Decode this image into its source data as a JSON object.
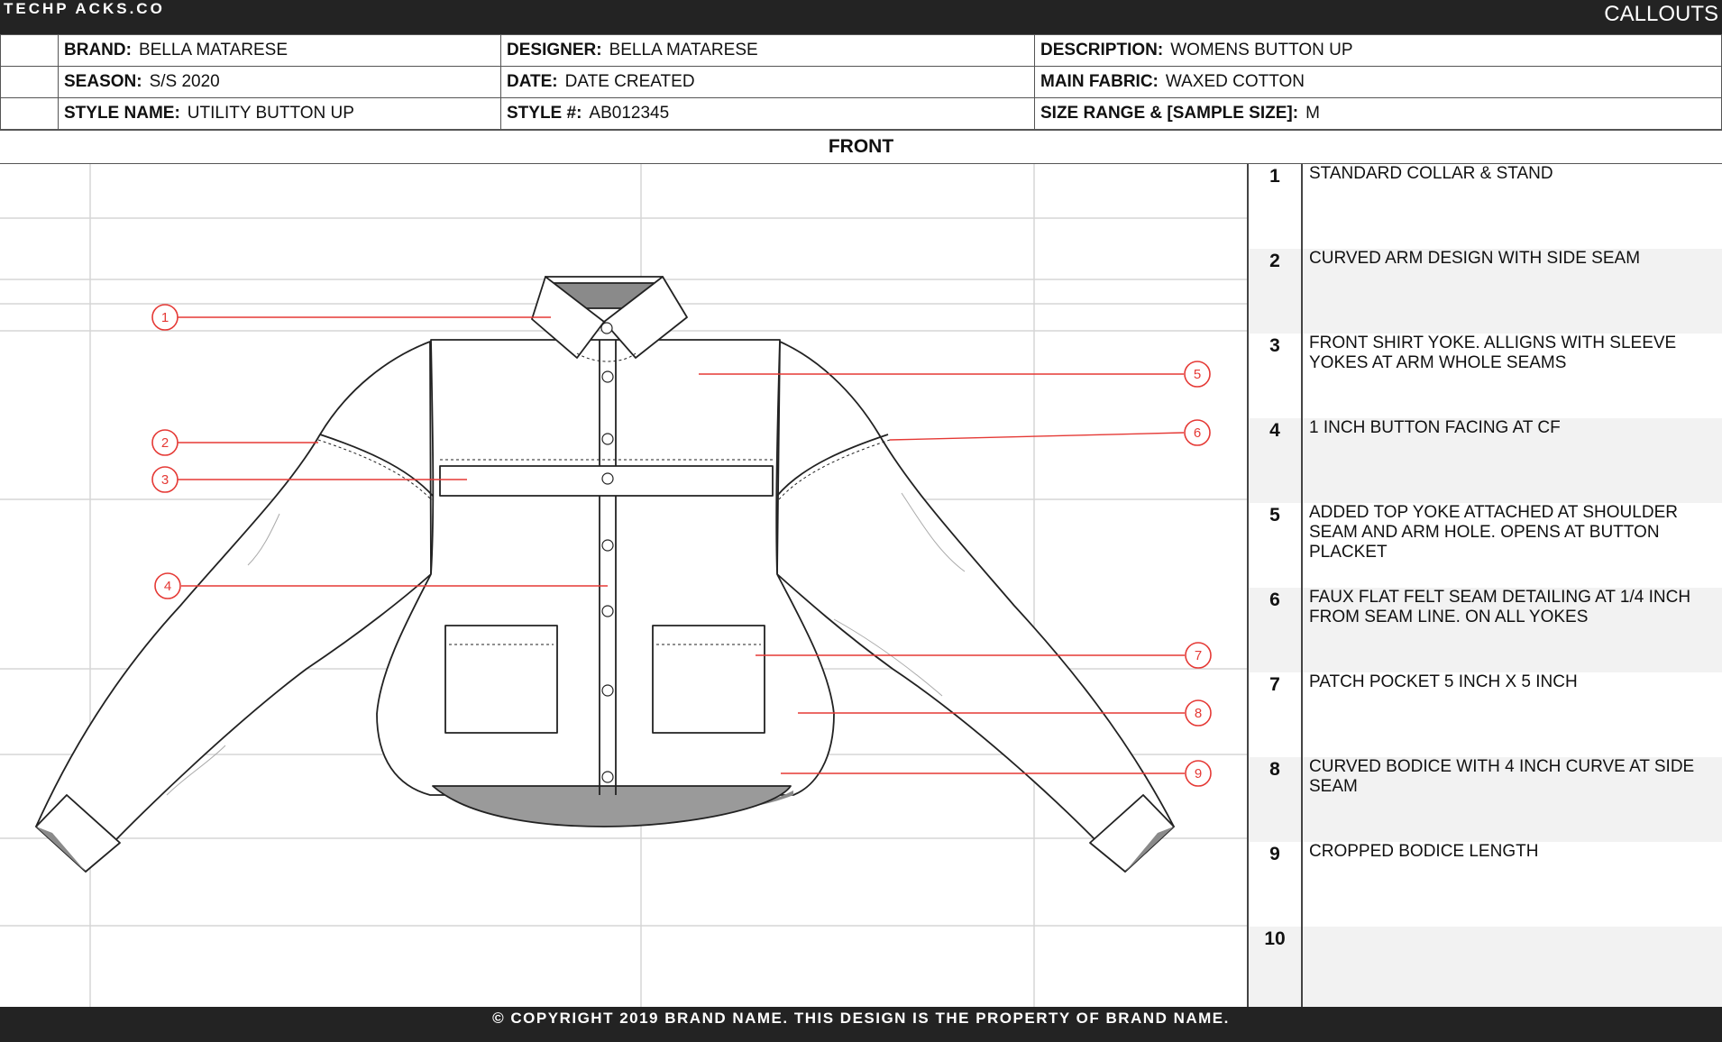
{
  "header": {
    "logo": "TECHP ACKS.CO",
    "section_title": "CALLOUTS"
  },
  "info": {
    "brand_label": "BRAND:",
    "brand_value": "BELLA MATARESE",
    "designer_label": "DESIGNER:",
    "designer_value": "BELLA MATARESE",
    "description_label": "DESCRIPTION:",
    "description_value": "WOMENS BUTTON UP",
    "season_label": "SEASON:",
    "season_value": "S/S 2020",
    "date_label": "DATE:",
    "date_value": "DATE CREATED",
    "fabric_label": "MAIN FABRIC:",
    "fabric_value": "WAXED COTTON",
    "style_name_label": "STYLE NAME:",
    "style_name_value": "UTILITY BUTTON UP",
    "style_num_label": "STYLE #:",
    "style_num_value": "AB012345",
    "size_label": "SIZE RANGE & [SAMPLE SIZE]:",
    "size_value": "M"
  },
  "view_title": "FRONT",
  "markers": [
    "1",
    "2",
    "3",
    "4",
    "5",
    "6",
    "7",
    "8",
    "9"
  ],
  "callouts": [
    {
      "num": "1",
      "text": "STANDARD COLLAR & STAND"
    },
    {
      "num": "2",
      "text": "CURVED ARM DESIGN WITH SIDE SEAM"
    },
    {
      "num": "3",
      "text": "FRONT SHIRT YOKE. ALLIGNS WITH SLEEVE YOKES AT ARM WHOLE SEAMS"
    },
    {
      "num": "4",
      "text": "1 INCH BUTTON FACING AT CF"
    },
    {
      "num": "5",
      "text": "ADDED TOP YOKE ATTACHED AT SHOULDER SEAM AND ARM HOLE. OPENS AT BUTTON PLACKET"
    },
    {
      "num": "6",
      "text": "FAUX FLAT FELT SEAM DETAILING AT 1/4 INCH FROM SEAM LINE. ON ALL YOKES"
    },
    {
      "num": "7",
      "text": "PATCH POCKET 5 INCH X 5 INCH"
    },
    {
      "num": "8",
      "text": "CURVED BODICE WITH 4 INCH CURVE AT SIDE SEAM"
    },
    {
      "num": "9",
      "text": "CROPPED BODICE LENGTH"
    },
    {
      "num": "10",
      "text": ""
    }
  ],
  "colors": {
    "callout_red": "#e53935",
    "bar_dark": "#232323",
    "shade_gray": "#8a8a8a"
  },
  "footer": {
    "copyright": "© COPYRIGHT 2019 BRAND NAME.  THIS DESIGN IS THE PROPERTY OF BRAND NAME."
  }
}
